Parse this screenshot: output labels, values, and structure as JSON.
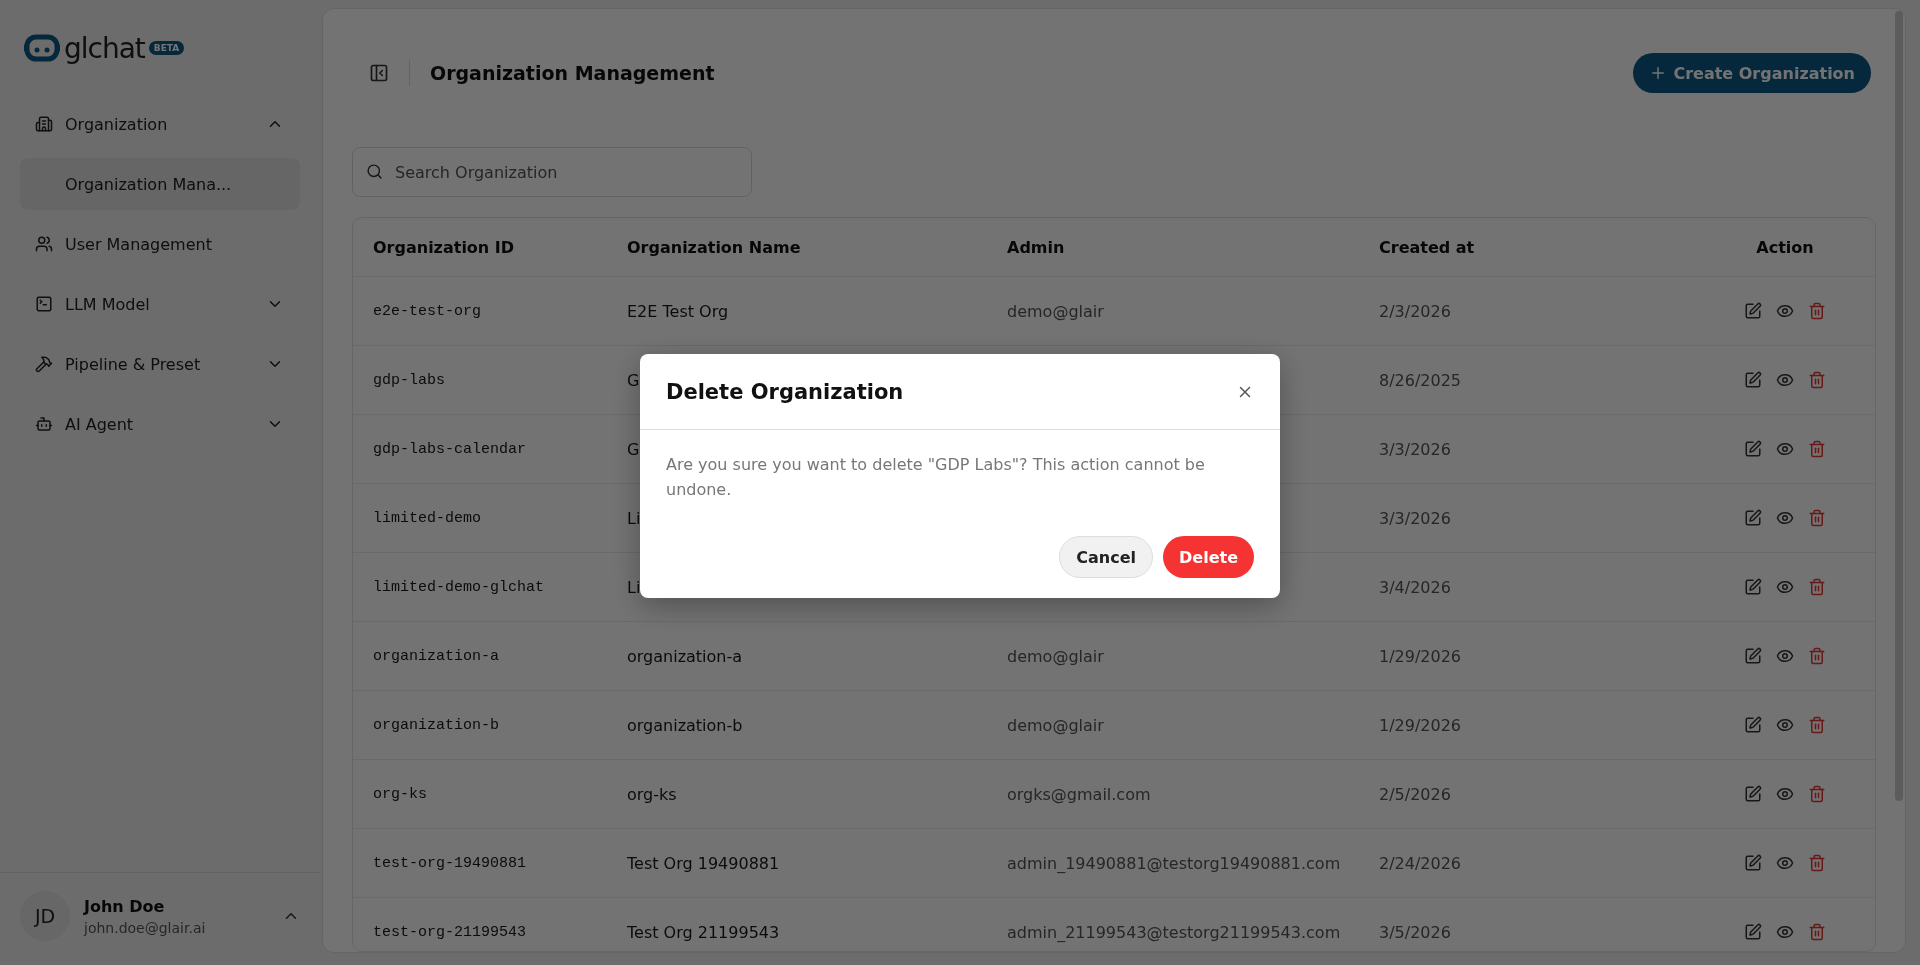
{
  "brand": {
    "name": "glchat",
    "badge": "BETA"
  },
  "sidebar": {
    "items": [
      {
        "label": "Organization",
        "kind": "group",
        "expanded": true,
        "children": [
          {
            "label": "Organization Mana...",
            "selected": true
          }
        ]
      },
      {
        "label": "User Management",
        "kind": "link"
      },
      {
        "label": "LLM Model",
        "kind": "group",
        "expanded": false
      },
      {
        "label": "Pipeline & Preset",
        "kind": "group",
        "expanded": false
      },
      {
        "label": "AI Agent",
        "kind": "group",
        "expanded": false
      }
    ]
  },
  "user": {
    "initials": "JD",
    "name": "John Doe",
    "email": "john.doe@glair.ai"
  },
  "header": {
    "title": "Organization Management",
    "create_button": "Create Organization"
  },
  "search": {
    "placeholder": "Search Organization"
  },
  "table": {
    "columns": [
      "Organization ID",
      "Organization Name",
      "Admin",
      "Created at",
      "Action"
    ],
    "rows": [
      {
        "id": "e2e-test-org",
        "name": "E2E Test Org",
        "admin": "demo@glair",
        "created": "2/3/2026"
      },
      {
        "id": "gdp-labs",
        "name": "G",
        "created": "8/26/2025"
      },
      {
        "id": "gdp-labs-calendar",
        "name": "G",
        "created": "3/3/2026"
      },
      {
        "id": "limited-demo",
        "name": "Li",
        "created": "3/3/2026"
      },
      {
        "id": "limited-demo-glchat",
        "name": "Li",
        "created": "3/4/2026"
      },
      {
        "id": "organization-a",
        "name": "organization-a",
        "admin": "demo@glair",
        "created": "1/29/2026"
      },
      {
        "id": "organization-b",
        "name": "organization-b",
        "admin": "demo@glair",
        "created": "1/29/2026"
      },
      {
        "id": "org-ks",
        "name": "org-ks",
        "admin": "orgks@gmail.com",
        "created": "2/5/2026"
      },
      {
        "id": "test-org-19490881",
        "name": "Test Org 19490881",
        "admin": "admin_19490881@testorg19490881.com",
        "created": "2/24/2026"
      },
      {
        "id": "test-org-21199543",
        "name": "Test Org 21199543",
        "admin": "admin_21199543@testorg21199543.com",
        "created": "3/5/2026"
      }
    ]
  },
  "dialog": {
    "title": "Delete Organization",
    "message": "Are you sure you want to delete \"GDP Labs\"? This action cannot be undone.",
    "buttons": [
      {
        "label": "Cancel",
        "kind": "secondary"
      },
      {
        "label": "Delete",
        "kind": "danger"
      }
    ]
  }
}
